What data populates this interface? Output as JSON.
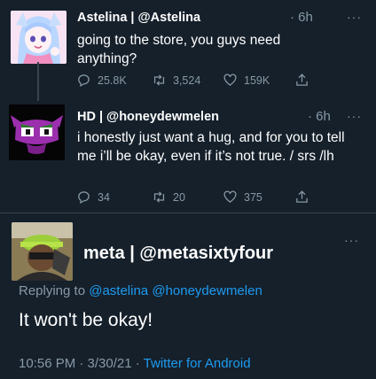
{
  "tweets": [
    {
      "display": "Astelina | @Astelina",
      "time": "· 6h",
      "text": "going to the store, you guys need anything?",
      "actions": {
        "replies": "25.8K",
        "retweets": "3,524",
        "likes": "159K"
      }
    },
    {
      "display": "HD | @honeydewmelen",
      "time": "· 6h",
      "text": "i honestly just want a hug, and for you to tell me i’ll be okay, even if it’s not true. / srs /lh",
      "actions": {
        "replies": "34",
        "retweets": "20",
        "likes": "375"
      }
    }
  ],
  "main": {
    "display": "meta | @metasixtyfour",
    "replying_prefix": "Replying to",
    "mention_1": "@astelina",
    "mention_2": "@honeydewmelen",
    "text": "It won't be okay!",
    "timestamp": "10:56 PM · 3/30/21 ·",
    "source": "Twitter for Android"
  },
  "more_label": "···",
  "colors": {
    "background": "#15202b",
    "muted": "#8899a6",
    "link": "#1d9bf0",
    "divider": "#38444d"
  },
  "icons": [
    "reply-icon",
    "retweet-icon",
    "like-icon",
    "share-icon",
    "more-icon"
  ]
}
